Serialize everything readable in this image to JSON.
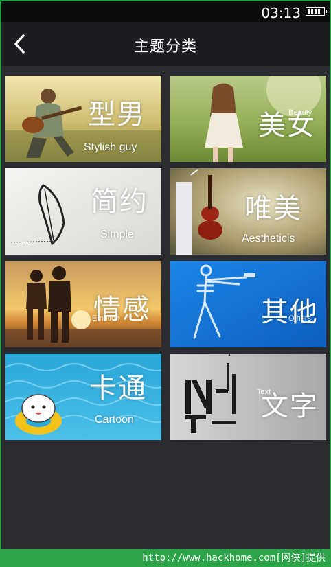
{
  "status_bar": {
    "time": "03:13",
    "battery_icon": "battery-full-icon"
  },
  "header": {
    "title": "主题分类",
    "back_icon": "back-arrow-icon"
  },
  "categories": [
    {
      "title": "型男",
      "subtitle": "Stylish guy"
    },
    {
      "title": "美女",
      "subtitle": "Beauty"
    },
    {
      "title": "简约",
      "subtitle": "Simple"
    },
    {
      "title": "唯美",
      "subtitle": "Aestheticis"
    },
    {
      "title": "情感",
      "subtitle": "Emotion"
    },
    {
      "title": "其他",
      "subtitle": "Others"
    },
    {
      "title": "卡通",
      "subtitle": "Cartoon"
    },
    {
      "title": "文字",
      "subtitle": "Text"
    }
  ],
  "watermark": "http://www.hackhome.com[网侠]提供",
  "colors": {
    "background": "#2a2c31",
    "titlebar": "#1c1d21",
    "statusbar": "#0d0d0e",
    "frame": "#2ea44a"
  }
}
